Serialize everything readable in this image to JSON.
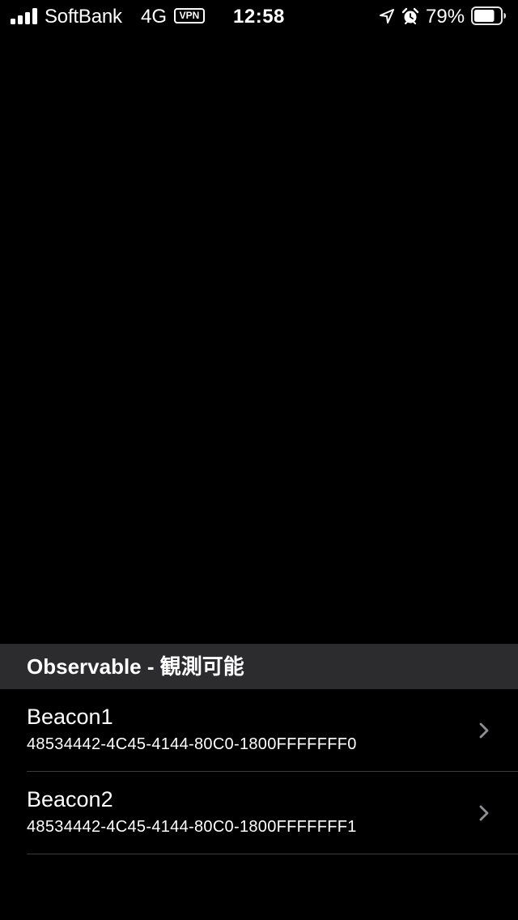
{
  "status_bar": {
    "carrier": "SoftBank",
    "network": "4G",
    "vpn": "VPN",
    "time": "12:58",
    "battery_percent": "79%",
    "battery_level": 0.79,
    "signal_bars": 4,
    "icons": [
      "signal-icon",
      "location-arrow-icon",
      "alarm-icon",
      "battery-icon"
    ]
  },
  "section": {
    "title": "Observable - 観測可能"
  },
  "beacons": [
    {
      "name": "Beacon1",
      "uuid": "48534442-4C45-4144-80C0-1800FFFFFFF0"
    },
    {
      "name": "Beacon2",
      "uuid": "48534442-4C45-4144-80C0-1800FFFFFFF1"
    }
  ],
  "colors": {
    "background": "#000000",
    "section_header": "#2c2c2e",
    "separator": "#3a3a3c",
    "chevron": "#8e8e93",
    "text": "#ffffff"
  }
}
